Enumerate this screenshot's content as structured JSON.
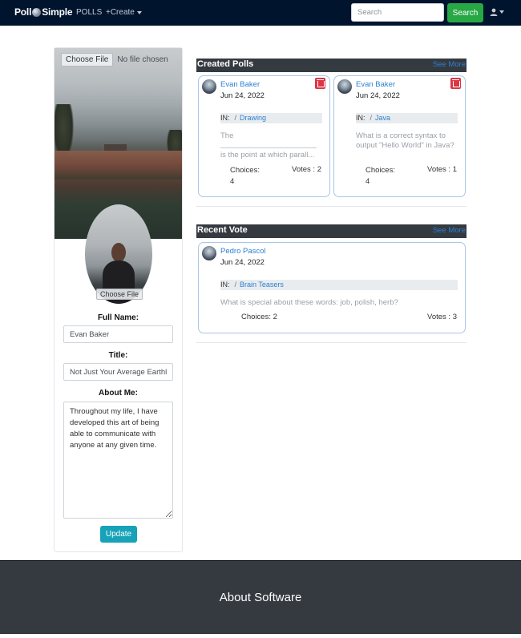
{
  "navbar": {
    "brand_left": "Poll",
    "brand_right": "Simple",
    "polls_link": "POLLS",
    "create_link": "+Create",
    "search_placeholder": "Search",
    "search_button": "Search",
    "user_icon": "user-icon"
  },
  "profile": {
    "cover_file_button": "Choose File",
    "cover_file_status": "No file chosen",
    "avatar_file_button": "Choose File",
    "full_name_label": "Full Name:",
    "full_name_value": "Evan Baker",
    "title_label": "Title:",
    "title_value": "Not Just Your Average Earthling",
    "about_label": "About Me:",
    "about_value": "Throughout my life, I have developed this art of being able to communicate with anyone at any given time.",
    "update_button": "Update"
  },
  "created_polls": {
    "title": "Created Polls",
    "see_more": "See More",
    "polls": [
      {
        "author": "Evan Baker",
        "date": "Jun 24, 2022",
        "in_label": "IN:",
        "separator": "/",
        "category": "Drawing",
        "question_line1": "The",
        "question_line2": "is the point at which parall...",
        "choices_label": "Choices:",
        "choices_count": "4",
        "votes": "Votes : 2"
      },
      {
        "author": "Evan Baker",
        "date": "Jun 24, 2022",
        "in_label": "IN:",
        "separator": "/",
        "category": "Java",
        "question": "What is a correct syntax to output \"Hello World\" in Java?",
        "choices_label": "Choices:",
        "choices_count": "4",
        "votes": "Votes : 1"
      }
    ]
  },
  "recent_vote": {
    "title": "Recent Vote",
    "see_more": "See More",
    "poll": {
      "author": "Pedro Pascol",
      "date": "Jun 24, 2022",
      "in_label": "IN:",
      "separator": "/",
      "category": "Brain Teasers",
      "question": "What is special about these words: job, polish, herb?",
      "choices": "Choices: 2",
      "votes": "Votes : 3"
    }
  },
  "footer": {
    "title": "About Software"
  },
  "colors": {
    "navbar": "#00142e",
    "search_button": "#28a745",
    "update_button": "#17a2b8",
    "section_header": "#343a40",
    "link": "#2d7fd1",
    "delete": "#dc3545",
    "footer": "#343a40"
  }
}
